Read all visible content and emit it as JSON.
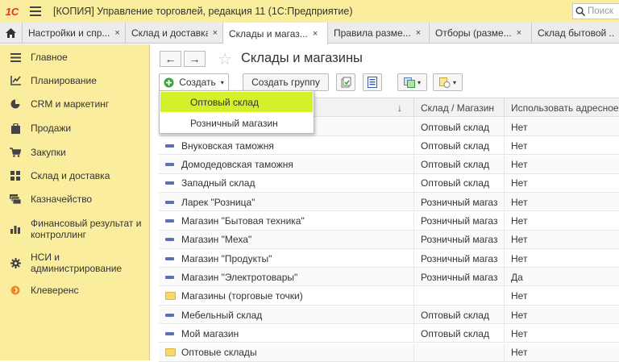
{
  "app": {
    "logo_text": "1С",
    "title": "[КОПИЯ] Управление торговлей, редакция 11  (1С:Предприятие)",
    "search_placeholder": "Поиск"
  },
  "tabs": [
    {
      "label": "Настройки и спр...",
      "active": false
    },
    {
      "label": "Склад и доставка",
      "active": false
    },
    {
      "label": "Склады и магаз...",
      "active": true
    },
    {
      "label": "Правила разме...",
      "active": false
    },
    {
      "label": "Отборы (разме...",
      "active": false
    },
    {
      "label": "Склад бытовой ...",
      "active": false
    }
  ],
  "tab_close_glyph": "×",
  "sidebar": {
    "items": [
      {
        "label": "Главное",
        "icon": "list-icon"
      },
      {
        "label": "Планирование",
        "icon": "chart-icon"
      },
      {
        "label": "CRM и маркетинг",
        "icon": "pie-icon"
      },
      {
        "label": "Продажи",
        "icon": "bag-icon"
      },
      {
        "label": "Закупки",
        "icon": "cart-icon"
      },
      {
        "label": "Склад и доставка",
        "icon": "grid-icon"
      },
      {
        "label": "Казначейство",
        "icon": "money-icon"
      },
      {
        "label": "Финансовый результат и контроллинг",
        "icon": "bar-chart-icon"
      },
      {
        "label": "НСИ и администрирование",
        "icon": "gear-icon"
      },
      {
        "label": "Клеверенс",
        "icon": "orange-circle-icon"
      }
    ]
  },
  "main": {
    "title": "Склады и магазины",
    "nav_back": "←",
    "nav_forward": "→",
    "star": "☆",
    "toolbar": {
      "create_label": "Создать",
      "create_group_label": "Создать группу"
    },
    "dropdown": [
      {
        "label": "Оптовый склад",
        "highlighted": true
      },
      {
        "label": "Розничный магазин",
        "highlighted": false
      }
    ],
    "table": {
      "columns": [
        "",
        "Склад / Магазин",
        "Использовать адресное х"
      ],
      "sort_glyph": "↓",
      "rows": [
        {
          "name": "",
          "type": "Оптовый склад",
          "addr": "Нет",
          "icon": "item"
        },
        {
          "name": "Внуковская таможня",
          "type": "Оптовый склад",
          "addr": "Нет",
          "icon": "item"
        },
        {
          "name": "Домодедовская таможня",
          "type": "Оптовый склад",
          "addr": "Нет",
          "icon": "item"
        },
        {
          "name": "Западный склад",
          "type": "Оптовый склад",
          "addr": "Нет",
          "icon": "item"
        },
        {
          "name": "Ларек \"Розница\"",
          "type": "Розничный магаз",
          "addr": "Нет",
          "icon": "item"
        },
        {
          "name": "Магазин \"Бытовая техника\"",
          "type": "Розничный магаз",
          "addr": "Нет",
          "icon": "item"
        },
        {
          "name": "Магазин \"Меха\"",
          "type": "Розничный магаз",
          "addr": "Нет",
          "icon": "item"
        },
        {
          "name": "Магазин \"Продукты\"",
          "type": "Розничный магаз",
          "addr": "Нет",
          "icon": "item"
        },
        {
          "name": "Магазин \"Электротовары\"",
          "type": "Розничный магаз",
          "addr": "Да",
          "icon": "item"
        },
        {
          "name": "Магазины (торговые точки)",
          "type": "",
          "addr": "Нет",
          "icon": "folder"
        },
        {
          "name": "Мебельный склад",
          "type": "Оптовый склад",
          "addr": "Нет",
          "icon": "item"
        },
        {
          "name": "Мой магазин",
          "type": "Оптовый склад",
          "addr": "Нет",
          "icon": "item"
        },
        {
          "name": "Оптовые склады",
          "type": "",
          "addr": "Нет",
          "icon": "folder"
        }
      ]
    }
  },
  "colors": {
    "panel": "#fbed9e",
    "highlight": "#d4f02a",
    "item_icon": "#5a6fb8",
    "folder": "#f7d96b"
  }
}
